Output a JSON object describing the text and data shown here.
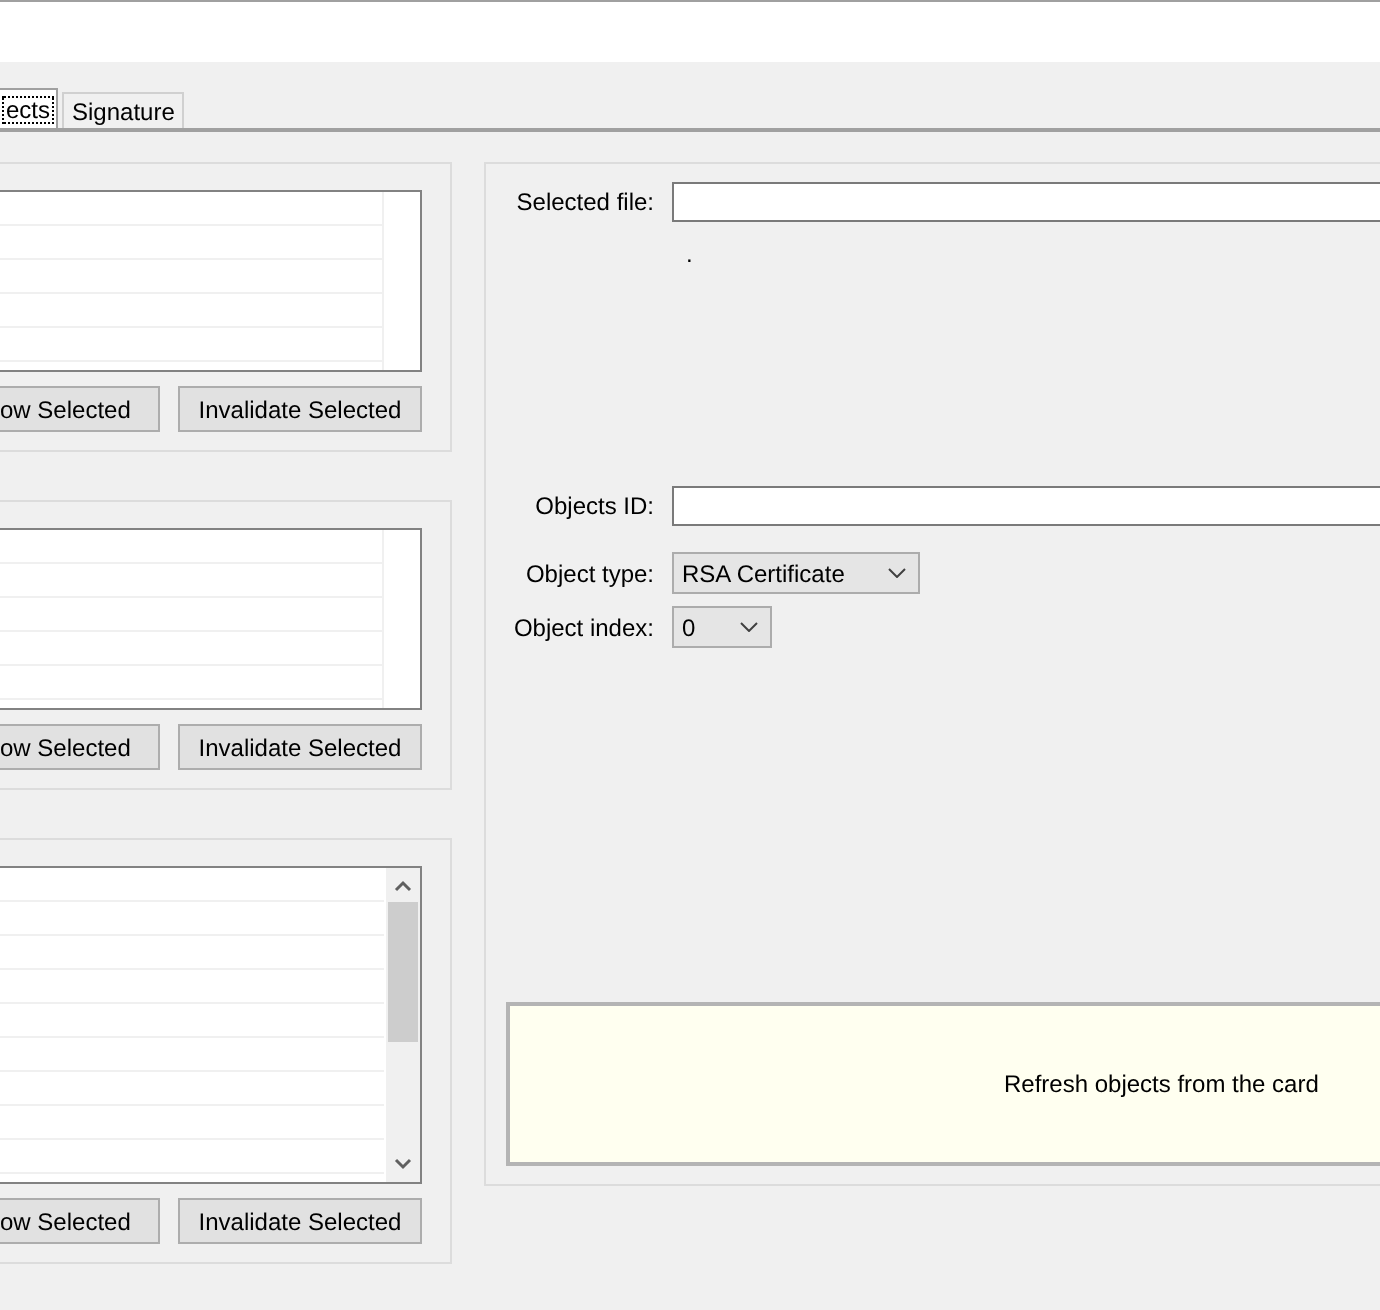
{
  "tabs": [
    {
      "label": "ects",
      "selected": true
    },
    {
      "label": "Signature",
      "selected": false
    }
  ],
  "lists": [
    {
      "scrollbar": false,
      "buttons": [
        "ow Selected",
        "Invalidate Selected"
      ]
    },
    {
      "scrollbar": false,
      "buttons": [
        "ow Selected",
        "Invalidate Selected"
      ]
    },
    {
      "scrollbar": true,
      "buttons": [
        "ow Selected",
        "Invalidate Selected"
      ]
    }
  ],
  "selected_file": {
    "label": "Selected file:"
  },
  "status_text": ".",
  "objects_id": {
    "label": "Objects ID:"
  },
  "object_type": {
    "label": "Object type:",
    "value": "RSA Certificate"
  },
  "object_index": {
    "label": "Object index:",
    "value": "0"
  },
  "refresh_panel": {
    "text": "Refresh objects from the card"
  }
}
